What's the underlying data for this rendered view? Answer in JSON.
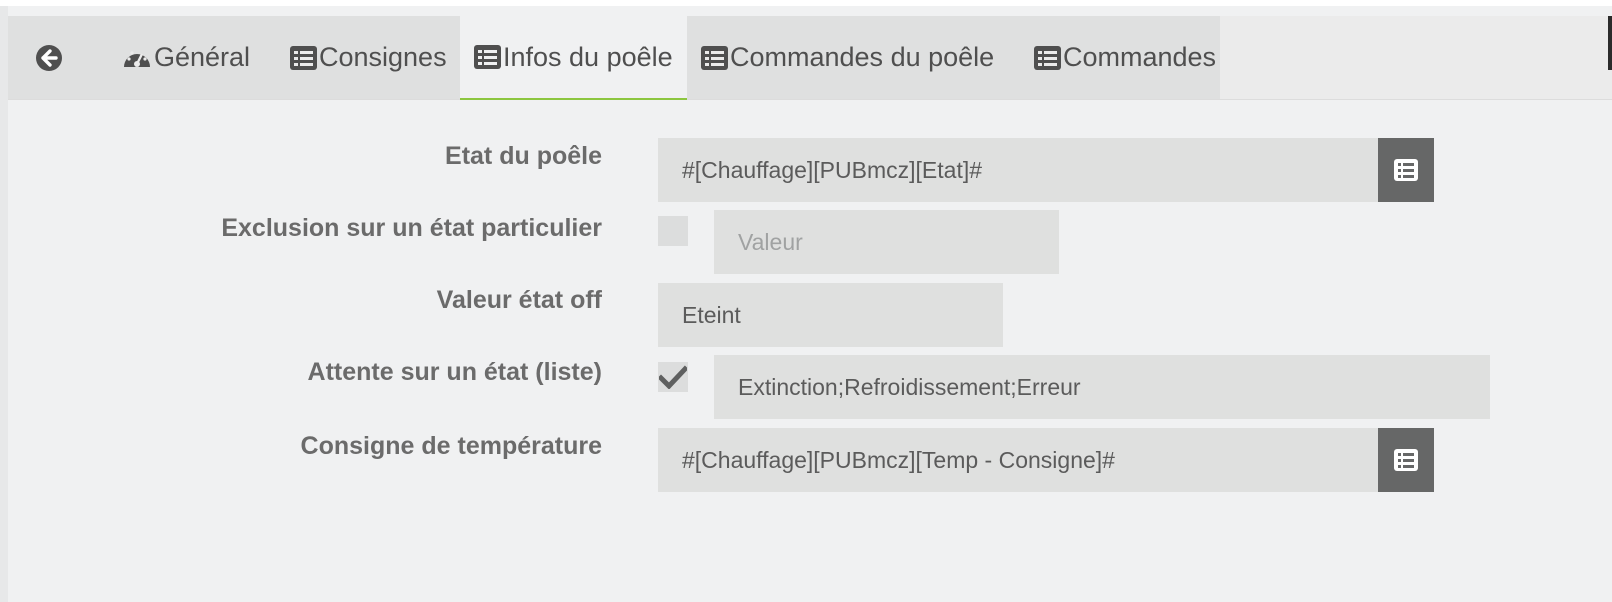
{
  "tabs": {
    "back_icon": "arrow-circle-left-icon",
    "items": [
      {
        "label": "Général",
        "icon": "dashboard-icon",
        "active": false
      },
      {
        "label": "Consignes",
        "icon": "list-alt-icon",
        "active": false
      },
      {
        "label": "Infos du poêle",
        "icon": "list-alt-icon",
        "active": true
      },
      {
        "label": "Commandes du poêle",
        "icon": "list-alt-icon",
        "active": false
      },
      {
        "label": "Commandes",
        "icon": "list-alt-icon",
        "active": false
      }
    ]
  },
  "form": {
    "etat": {
      "label": "Etat du poêle",
      "value": "#[Chauffage][PUBmcz][Etat]#",
      "button_icon": "list-alt-icon"
    },
    "exclusion": {
      "label": "Exclusion sur un état particulier",
      "checked": false,
      "placeholder": "Valeur"
    },
    "valeur_off": {
      "label": "Valeur état off",
      "value": "Eteint"
    },
    "attente": {
      "label": "Attente sur un état (liste)",
      "checked": true,
      "value": "Extinction;Refroidissement;Erreur"
    },
    "consigne": {
      "label": "Consigne de température",
      "value": "#[Chauffage][PUBmcz][Temp - Consigne]#",
      "button_icon": "list-alt-icon"
    }
  },
  "colors": {
    "active_tab_underline": "#8cc63f",
    "button_bg": "#666767",
    "field_bg": "#dfe0df",
    "label_text": "#6b6b6b"
  }
}
